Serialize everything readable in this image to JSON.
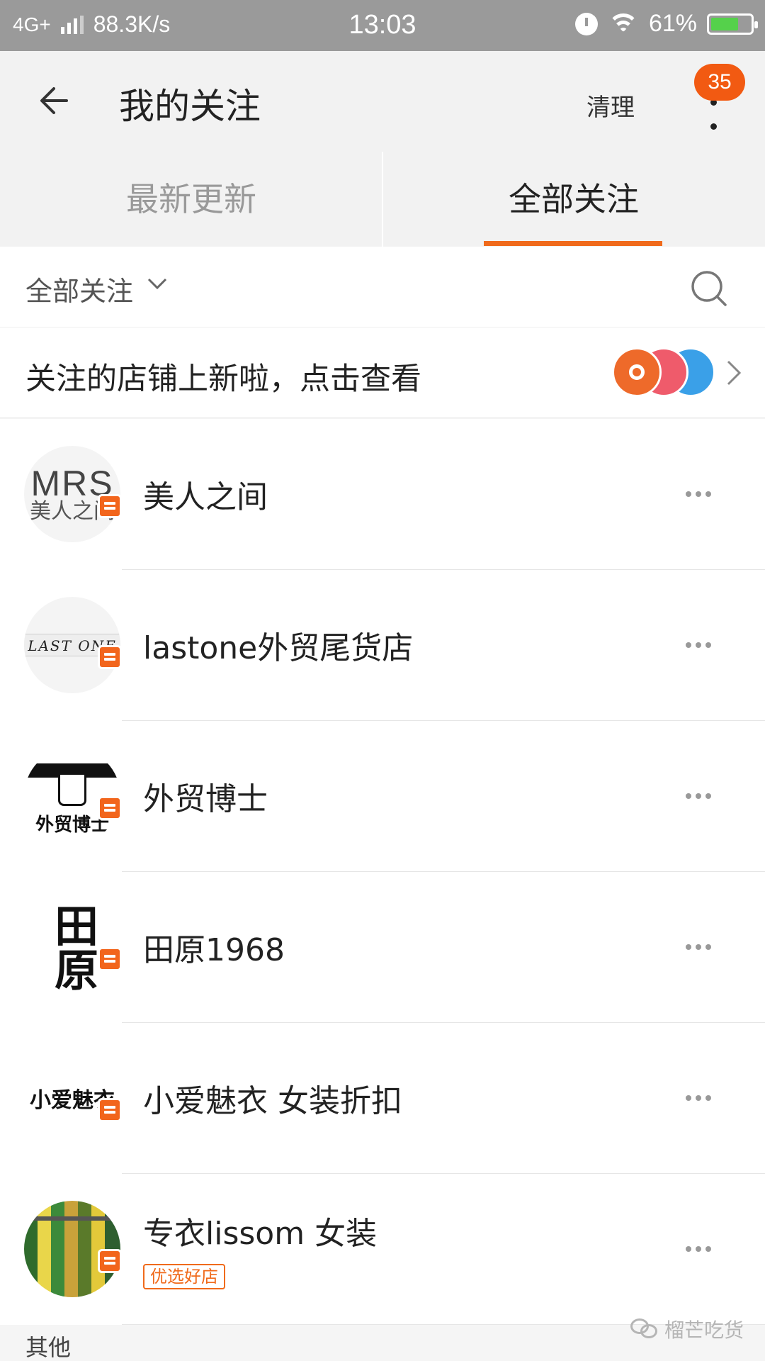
{
  "status_bar": {
    "network": "4G+",
    "speed": "88.3K/s",
    "time": "13:03",
    "battery": "61%"
  },
  "header": {
    "title": "我的关注",
    "clear_label": "清理",
    "badge_count": "35"
  },
  "tabs": [
    {
      "label": "最新更新",
      "active": false
    },
    {
      "label": "全部关注",
      "active": true
    }
  ],
  "filter": {
    "label": "全部关注"
  },
  "banner": {
    "text": "关注的店铺上新啦，点击查看"
  },
  "avatars": {
    "shop1_big": "MRS",
    "shop1_small": "美人之间",
    "shop2": "LAST ONE",
    "shop3": "外贸博士",
    "shop4": "田原",
    "shop5": "小爱魅衣"
  },
  "shops": [
    {
      "name": "美人之间"
    },
    {
      "name": "lastone外贸尾货店"
    },
    {
      "name": "外贸博士"
    },
    {
      "name": "田原1968"
    },
    {
      "name": "小爱魅衣 女装折扣"
    },
    {
      "name": "专衣lissom  女装",
      "tag": "优选好店"
    }
  ],
  "footer": {
    "section_label": "其他",
    "watermark": "榴芒吃货"
  },
  "colors": {
    "accent": "#f06a1b",
    "badge": "#f25a12",
    "status_bar": "#9a9a9a"
  }
}
